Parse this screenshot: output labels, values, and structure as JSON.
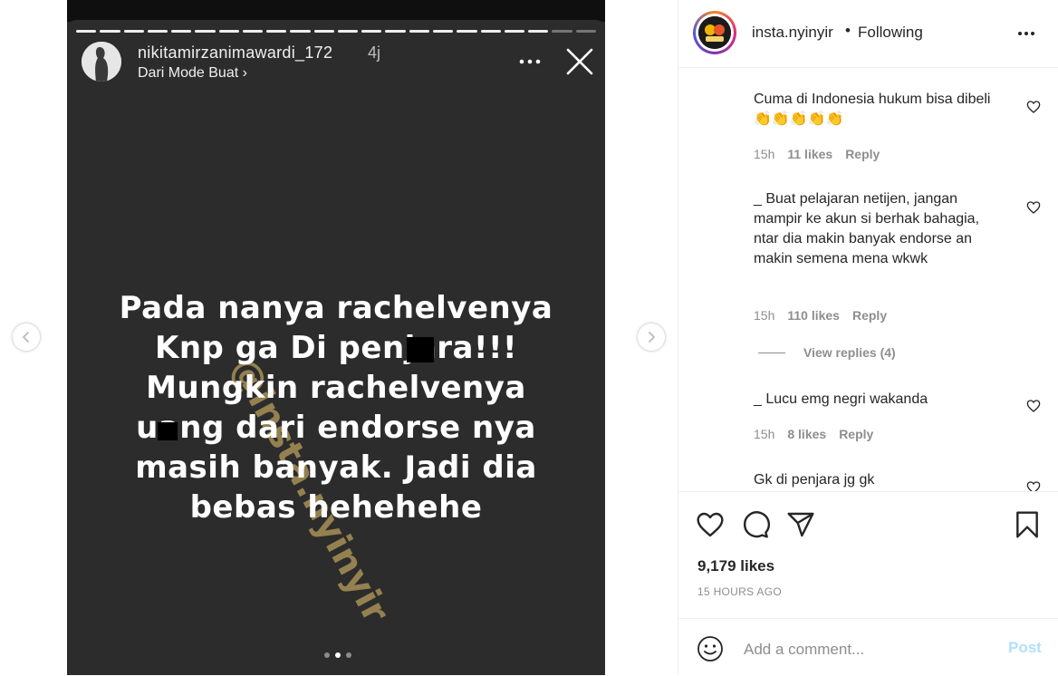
{
  "story": {
    "username": "nikitamirzanimawardi_172",
    "time": "4j",
    "subtitle": "Dari Mode Buat ›",
    "text": "Pada nanya rachelvenya\nKnp ga Di penjara!!!\nMungkin rachelvenya\nuang dari endorse nya\nmasih banyak. Jadi dia\nbebas hehehehe",
    "watermark": "@insta.nyinyir",
    "progress_segments_total": 22,
    "progress_segments_viewed": 20,
    "pager_dots": 3,
    "pager_active": 1
  },
  "header": {
    "username": "insta.nyinyir",
    "separator": "•",
    "follow_label": "Following"
  },
  "comments": [
    {
      "text": "Cuma di Indonesia hukum bisa dibeli 👏👏👏👏👏",
      "time": "15h",
      "likes": "11 likes",
      "reply": "Reply"
    },
    {
      "text": "_ Buat pelajaran netijen, jangan mampir ke akun si berhak bahagia, ntar dia makin banyak endorse an makin semena mena wkwk",
      "time": "15h",
      "likes": "110 likes",
      "reply": "Reply"
    },
    {
      "text": "_ Lucu emg negri wakanda",
      "time": "15h",
      "likes": "8 likes",
      "reply": "Reply"
    },
    {
      "text": "Gk di penjara jg gk"
    }
  ],
  "view_replies": "View replies (4)",
  "likes_count": "9,179 likes",
  "post_time": "15 HOURS AGO",
  "add_comment": {
    "placeholder": "Add a comment...",
    "post_label": "Post"
  },
  "colors": {
    "link_disabled": "#b2dffc",
    "muted": "#8e8e8e",
    "text": "#262626",
    "story_bg": "#2c2c2c"
  }
}
